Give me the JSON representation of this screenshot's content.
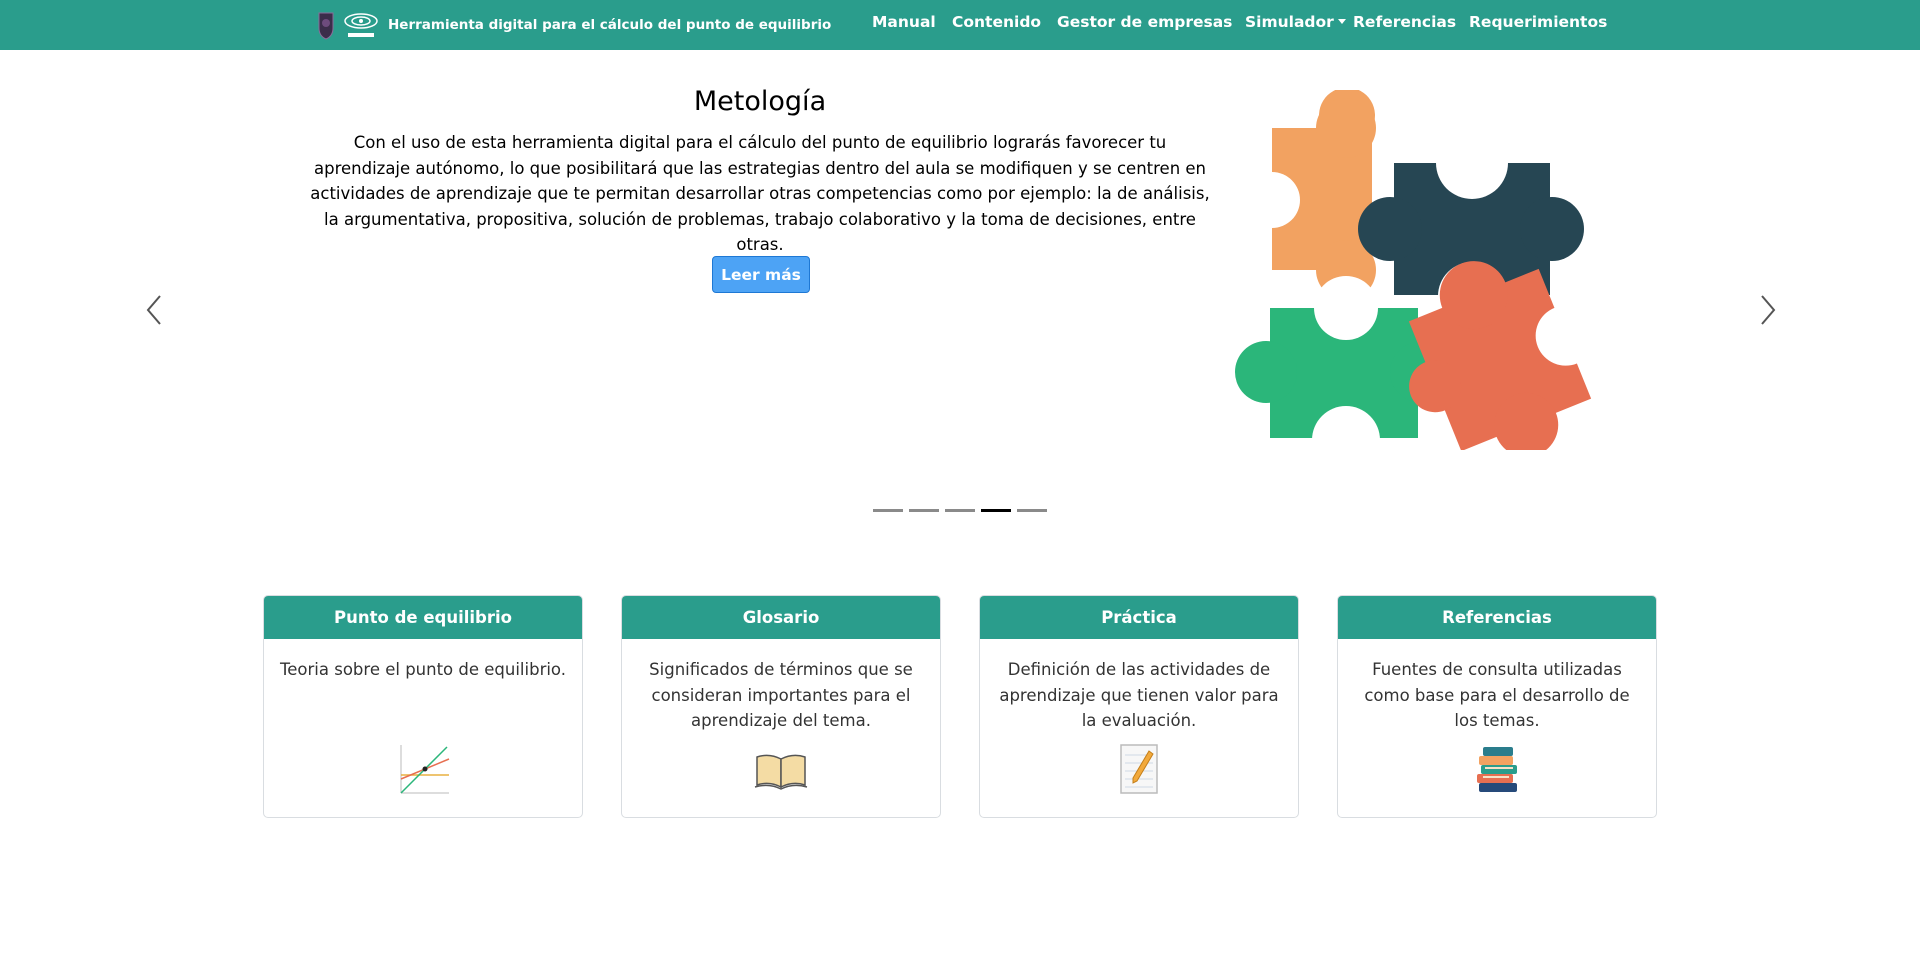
{
  "navbar": {
    "brand_text": "Herramienta digital para el cálculo del punto de equilibrio",
    "items": [
      {
        "label": "Manual"
      },
      {
        "label": "Contenido"
      },
      {
        "label": "Gestor de empresas"
      },
      {
        "label": "Simulador"
      },
      {
        "label": "Referencias"
      },
      {
        "label": "Requerimientos"
      }
    ],
    "color": "#2a9d8c"
  },
  "carousel": {
    "title": "Metología",
    "text": "Con el uso de esta herramienta digital para el cálculo del punto de equilibrio lograrás favorecer tu aprendizaje autónomo, lo que posibilitará que las estrategias dentro del aula se modifiquen y se centren en actividades de aprendizaje que te permitan desarrollar otras competencias como por ejemplo: la de análisis, la argumentativa, propositiva, solución de problemas, trabajo colaborativo y la toma de decisiones, entre otras.",
    "button_label": "Leer más",
    "image": "puzzle-pieces",
    "slide_count": 5,
    "active_slide": 4,
    "prev_icon": "chevron-left-icon",
    "next_icon": "chevron-right-icon"
  },
  "cards": [
    {
      "title": "Punto de equilibrio",
      "text": "Teoria sobre el punto de equilibrio.",
      "icon": "equilibrium-chart-icon"
    },
    {
      "title": "Glosario",
      "text": "Significados de términos que se consideran importantes para el aprendizaje del tema.",
      "icon": "open-book-icon"
    },
    {
      "title": "Práctica",
      "text": "Definición de las actividades de aprendizaje que tienen valor para la evaluación.",
      "icon": "notepad-pencil-icon"
    },
    {
      "title": "Referencias",
      "text": "Fuentes de consulta utilizadas como base para el desarrollo de los temas.",
      "icon": "book-stack-icon"
    }
  ],
  "colors": {
    "primary": "#2a9d8c",
    "button": "#4da3f5",
    "puzzle_orange": "#f2a261",
    "puzzle_navy": "#264653",
    "puzzle_green": "#2bb67a",
    "puzzle_red": "#e76f51"
  }
}
